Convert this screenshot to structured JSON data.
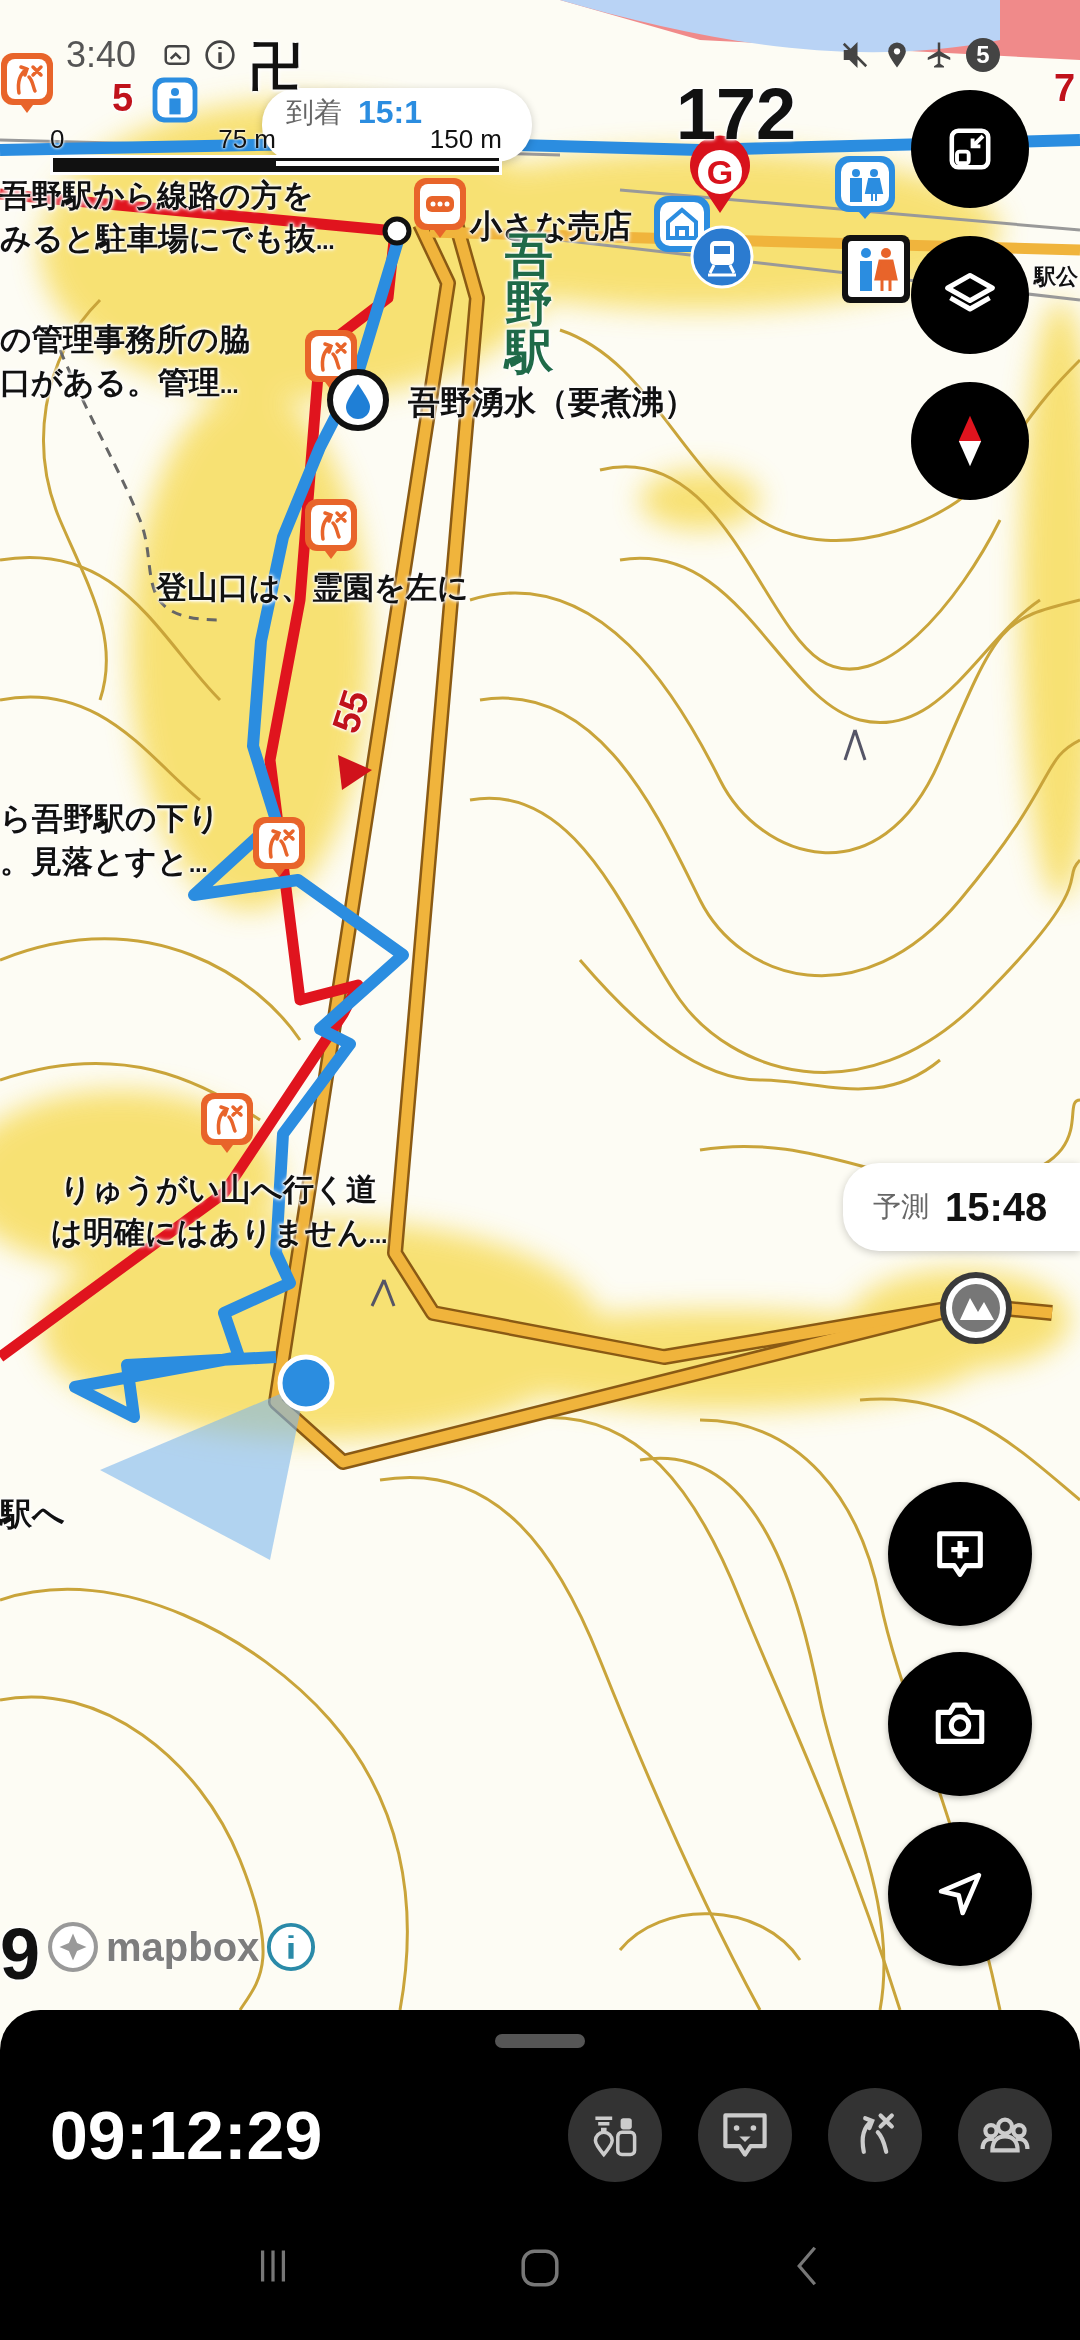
{
  "status_bar": {
    "time": "3:40",
    "notification_count": "5"
  },
  "map": {
    "scale_bar": {
      "labels": [
        "0",
        "75 m",
        "150 m"
      ]
    },
    "arrival_callout": {
      "label": "到着",
      "time": "15:1"
    },
    "goal_marker": "G",
    "labels": [
      {
        "kind": "route-number",
        "text": "5"
      },
      {
        "kind": "symbol",
        "text": "卍"
      },
      {
        "kind": "elevation",
        "text": "172"
      },
      {
        "kind": "route-number",
        "text": "7"
      },
      {
        "kind": "note",
        "text": "吾野駅から線路の方をみると駐車場にでも抜…"
      },
      {
        "kind": "place",
        "text": "小さな売店"
      },
      {
        "kind": "place-small",
        "text": "駅公"
      },
      {
        "kind": "note",
        "text": "の管理事務所の脇口がある。管理…"
      },
      {
        "kind": "station",
        "text": "吾野駅"
      },
      {
        "kind": "place",
        "text": "吾野湧水（要煮沸）"
      },
      {
        "kind": "caption",
        "text": "登山口は、霊園を左に"
      },
      {
        "kind": "road-number",
        "text": "55"
      },
      {
        "kind": "note",
        "text": "ら吾野駅の下り。見落とすと…"
      },
      {
        "kind": "note-center",
        "text": "りゅうがい山へ行く道は明確にはありません…"
      },
      {
        "kind": "place",
        "text": "駅へ"
      },
      {
        "kind": "elevation",
        "text": "9"
      }
    ],
    "forecast_callout": {
      "label": "予測",
      "time": "15:48"
    },
    "attribution": "mapbox"
  },
  "bottom_sheet": {
    "elapsed_time": "09:12:29"
  }
}
